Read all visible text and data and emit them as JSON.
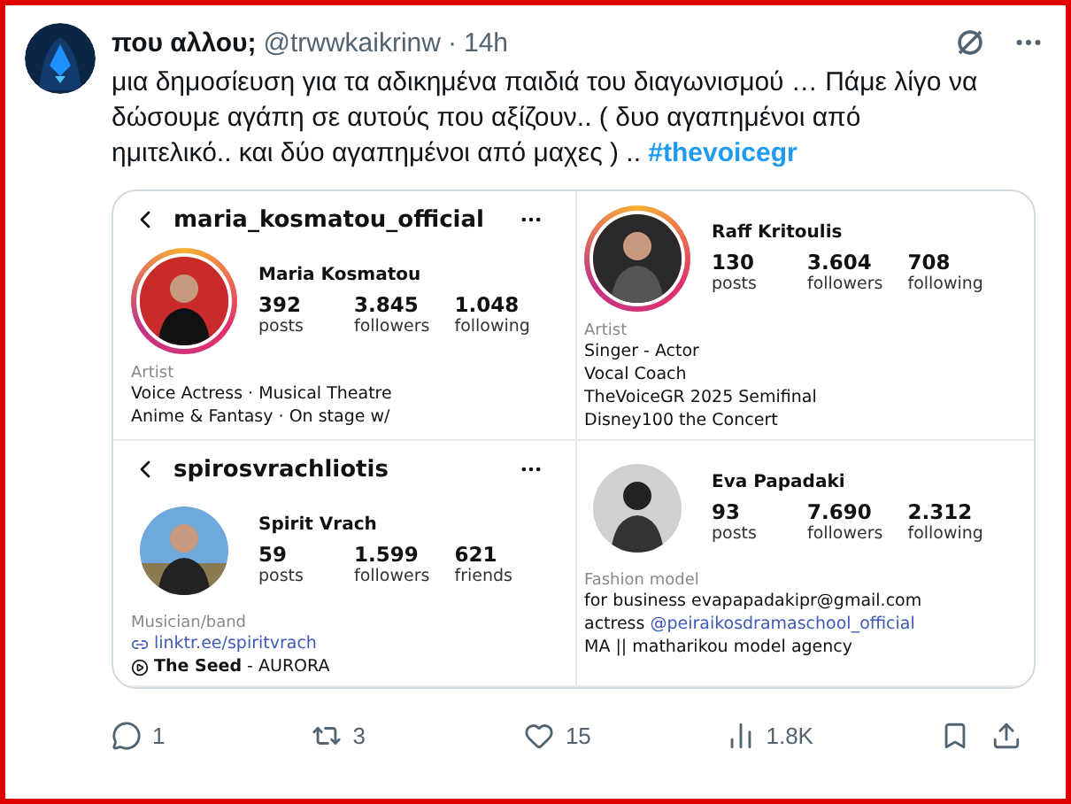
{
  "tweet": {
    "author": {
      "name": "που αλλου;",
      "handle": "@trwwkaikrinw",
      "separator": "·",
      "time": "14h"
    },
    "text": "μια δημοσίευση για τα αδικημένα παιδιά του διαγωνισμού … Πάμε λίγο να δώσουμε αγάπη σε αυτούς που αξίζουν.. ( δυο αγαπημένοι από ημιτελικό.. και δύο αγαπημένοι από μαχες ) ..",
    "hashtag": "#thevoicegr"
  },
  "profiles": [
    {
      "username": "maria_kosmatou_official",
      "name": "Maria Kosmatou",
      "story_ring": true,
      "stats": [
        {
          "value": "392",
          "label": "posts"
        },
        {
          "value": "3.845",
          "label": "followers"
        },
        {
          "value": "1.048",
          "label": "following"
        }
      ],
      "category": "Artist",
      "bio": [
        {
          "kind": "text",
          "text": "Voice Actress · Musical Theatre"
        },
        {
          "kind": "text",
          "text": "Anime & Fantasy · On stage w/"
        }
      ]
    },
    {
      "name": "Raff Kritoulis",
      "story_ring": true,
      "stats": [
        {
          "value": "130",
          "label": "posts"
        },
        {
          "value": "3.604",
          "label": "followers"
        },
        {
          "value": "708",
          "label": "following"
        }
      ],
      "category": "Artist",
      "bio": [
        {
          "kind": "text",
          "text": "Singer - Actor"
        },
        {
          "kind": "text",
          "text": "Vocal Coach"
        },
        {
          "kind": "text",
          "text": "TheVoiceGR 2025 Semifinal"
        },
        {
          "kind": "text",
          "text": "Disney100 the Concert"
        }
      ]
    },
    {
      "username": "spirosvrachliotis",
      "name": "Spirit Vrach",
      "story_ring": false,
      "stats": [
        {
          "value": "59",
          "label": "posts"
        },
        {
          "value": "1.599",
          "label": "followers"
        },
        {
          "value": "621",
          "label": "friends"
        }
      ],
      "category": "Musician/band",
      "bio": [
        {
          "kind": "link",
          "text": "linktr.ee/spiritvrach"
        },
        {
          "kind": "music",
          "text": "**The Seed** - AURORA"
        }
      ]
    },
    {
      "name": "Eva Papadaki",
      "story_ring": false,
      "stats": [
        {
          "value": "93",
          "label": "posts"
        },
        {
          "value": "7.690",
          "label": "followers"
        },
        {
          "value": "2.312",
          "label": "following"
        }
      ],
      "category": "Fashion model",
      "bio": [
        {
          "kind": "text",
          "text": "for business evapapadakipr@gmail.com"
        },
        {
          "kind": "mention",
          "text": "actress",
          "mention": "@peiraikosdramaschool_official"
        },
        {
          "kind": "text",
          "text": "MA || matharikou model agency"
        }
      ]
    }
  ],
  "actions": [
    {
      "kind": "reply",
      "count": "1"
    },
    {
      "kind": "repost",
      "count": "3"
    },
    {
      "kind": "like",
      "count": "15"
    },
    {
      "kind": "views",
      "count": "1.8K"
    },
    {
      "kind": "bookmark"
    },
    {
      "kind": "share"
    }
  ]
}
